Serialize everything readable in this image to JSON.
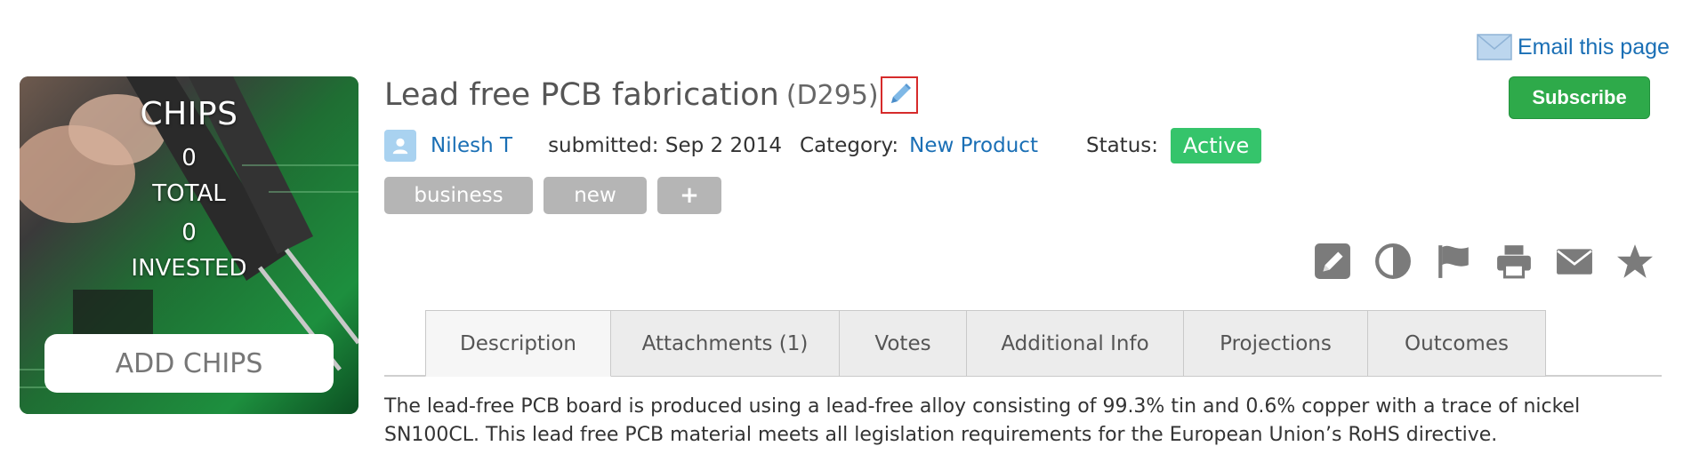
{
  "email_link": {
    "label": "Email this page"
  },
  "chips": {
    "title": "CHIPS",
    "total_value": "0",
    "total_label": "TOTAL",
    "invested_value": "0",
    "invested_label": "INVESTED",
    "add_button": "ADD CHIPS"
  },
  "idea": {
    "title": "Lead free PCB fabrication",
    "id": "(D295)",
    "author": "Nilesh T",
    "submitted": "submitted: Sep 2 2014",
    "category_label": "Category:",
    "category": "New Product",
    "status_label": "Status:",
    "status": "Active",
    "status_color": "#35c46b"
  },
  "subscribe_button": "Subscribe",
  "tags": [
    "business",
    "new",
    "+"
  ],
  "actions": [
    "edit-icon",
    "contrast-icon",
    "flag-icon",
    "print-icon",
    "envelope-icon",
    "star-icon"
  ],
  "tabs": [
    "Description",
    "Attachments (1)",
    "Votes",
    "Additional Info",
    "Projections",
    "Outcomes"
  ],
  "active_tab": "Description",
  "description": "The lead-free PCB board is produced using a lead-free alloy consisting of 99.3% tin and 0.6% copper with a trace of nickel SN100CL. This lead free PCB material meets all legislation requirements for the European Union’s RoHS directive."
}
